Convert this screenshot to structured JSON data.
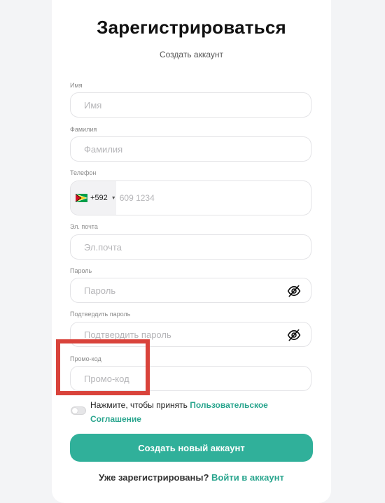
{
  "form": {
    "title": "Зарегистрироваться",
    "subtitle": "Создать аккаунт",
    "first_name": {
      "label": "Имя",
      "placeholder": "Имя"
    },
    "last_name": {
      "label": "Фамилия",
      "placeholder": "Фамилия"
    },
    "phone": {
      "label": "Телефон",
      "country_flag": "guyana-flag-icon",
      "country_code": "+592",
      "placeholder": "609 1234"
    },
    "email": {
      "label": "Эл. почта",
      "placeholder": "Эл.почта"
    },
    "password": {
      "label": "Пароль",
      "placeholder": "Пароль",
      "toggle_icon": "eye-off-icon"
    },
    "confirm_password": {
      "label": "Подтвердить пароль",
      "placeholder": "Подтвердить пароль",
      "toggle_icon": "eye-off-icon"
    },
    "promo": {
      "label": "Промо-код",
      "placeholder": "Промо-код"
    },
    "terms": {
      "prefix": "Нажмите, чтобы принять ",
      "link": "Пользовательское Соглашение",
      "accepted": false
    },
    "submit_label": "Создать новый аккаунт",
    "login_prompt": "Уже зарегистрированы? ",
    "login_link": "Войти в аккаунт"
  },
  "colors": {
    "accent": "#30b09a",
    "link": "#2aa58e",
    "highlight": "#d9433b"
  }
}
